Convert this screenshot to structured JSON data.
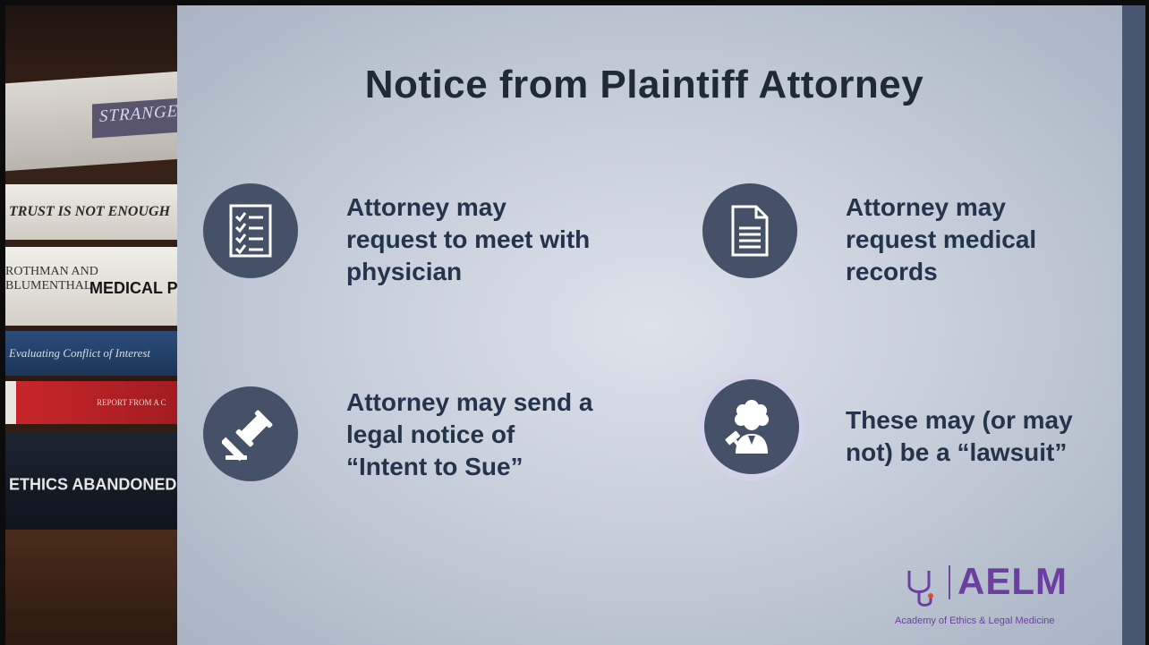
{
  "slide": {
    "title": "Notice from Plaintiff Attorney",
    "items": [
      {
        "icon": "checklist-icon",
        "text_lines": [
          "Attorney may",
          "request to meet with",
          "physician"
        ]
      },
      {
        "icon": "document-icon",
        "text_lines": [
          "Attorney may",
          "request medical",
          "records"
        ]
      },
      {
        "icon": "gavel-icon",
        "text_lines": [
          "Attorney may send a",
          "legal notice of",
          "“Intent to Sue”"
        ]
      },
      {
        "icon": "judge-icon",
        "text_lines": [
          "These may (or may",
          "not) be a “lawsuit”"
        ]
      }
    ]
  },
  "photo": {
    "books": [
      "STRANGERS",
      "TRUST IS NOT ENOUGH",
      "ROTHMAN AND",
      "BLUMENTHAL",
      "MEDICAL P",
      "Evaluating Conflict of Interest",
      "REPORT FROM A C",
      "ETHICS ABANDONED"
    ]
  },
  "logo": {
    "brand": "AELM",
    "tagline": "Academy of Ethics & Legal Medicine"
  },
  "colors": {
    "title": "#1f2a39",
    "text": "#24344b",
    "icon_circle": "#445166",
    "accent_bar": "#4a5770",
    "logo": "#6a3fa0"
  }
}
